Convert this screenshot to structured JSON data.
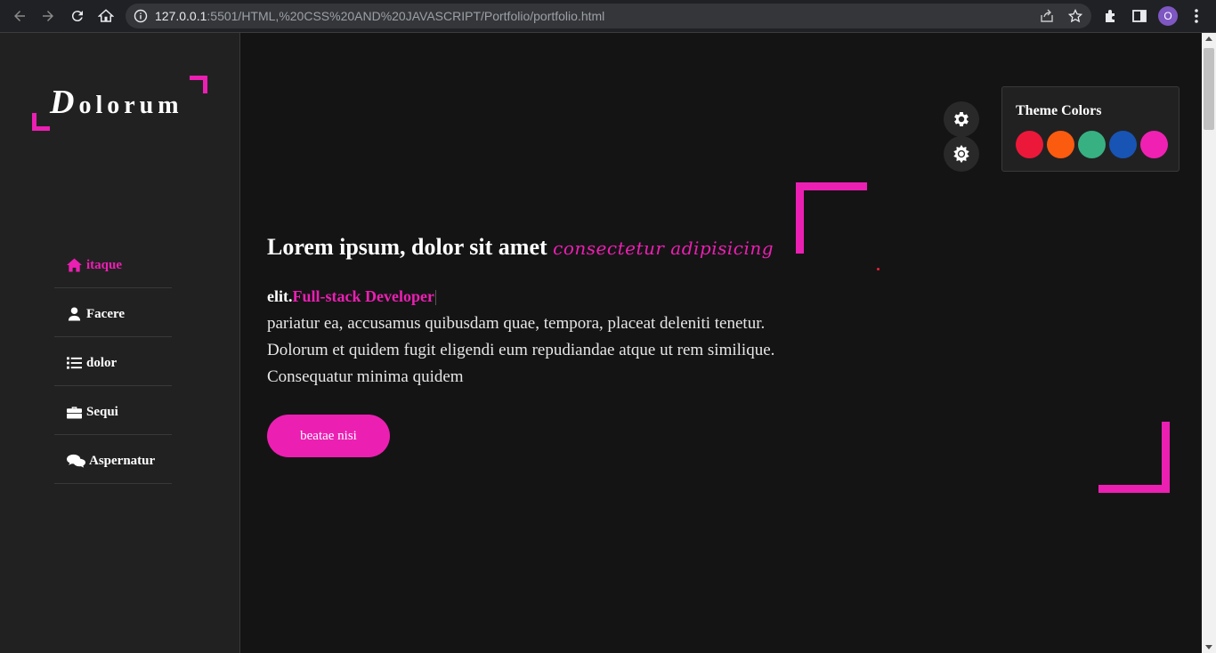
{
  "browser": {
    "url_host": "127.0.0.1",
    "url_rest": ":5501/HTML,%20CSS%20AND%20JAVASCRIPT/Portfolio/portfolio.html",
    "profile_initial": "O"
  },
  "sidebar": {
    "logo_first": "D",
    "logo_rest": "olorum",
    "accent_color": "#ec1fb3",
    "items": [
      {
        "label": "itaque",
        "icon": "home-icon",
        "active": true
      },
      {
        "label": "Facere",
        "icon": "user-icon",
        "active": false
      },
      {
        "label": "dolor",
        "icon": "list-icon",
        "active": false
      },
      {
        "label": "Sequi",
        "icon": "briefcase-icon",
        "active": false
      },
      {
        "label": "Aspernatur",
        "icon": "comments-icon",
        "active": false
      }
    ]
  },
  "hero": {
    "headline": "Lorem ipsum, dolor sit amet ",
    "headline_accent": "consectetur adipisicing",
    "typed_prefix": "elit.",
    "typed_role": "Full-stack Developer",
    "paragraph": "pariatur ea, accusamus quibusdam quae, tempora, placeat deleniti tenetur. Dolorum et quidem fugit eligendi eum repudiandae atque ut rem similique. Consequatur minima quidem",
    "cta_label": "beatae nisi"
  },
  "theme_panel": {
    "title": "Theme Colors",
    "colors": [
      "#ec1839",
      "#fa5b0f",
      "#37b182",
      "#1854b4",
      "#f021b2"
    ]
  },
  "controls": {
    "settings_icon": "gear-icon",
    "mode_icon": "sun-icon"
  }
}
